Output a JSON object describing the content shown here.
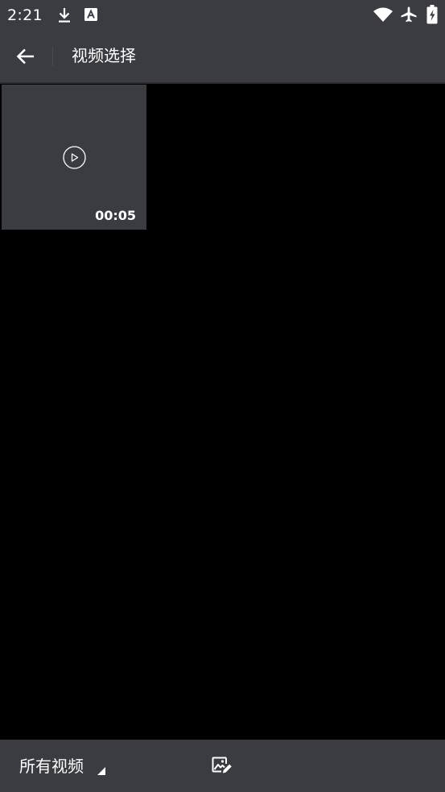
{
  "status_bar": {
    "time": "2:21",
    "icons": [
      "download-icon",
      "text-a-icon",
      "wifi-icon",
      "airplane-mode-icon",
      "battery-charging-icon"
    ]
  },
  "app_bar": {
    "title": "视频选择",
    "back_icon": "arrow-back-icon"
  },
  "grid": {
    "items": [
      {
        "duration": "00:05",
        "icon": "play-circle-icon"
      }
    ]
  },
  "bottom_bar": {
    "album_label": "所有视频",
    "dropdown_icon": "dropdown-triangle-icon",
    "edit_icon": "image-edit-icon"
  },
  "colors": {
    "bar_background": "#3b3c42",
    "content_background": "#000000",
    "foreground": "#ffffff"
  }
}
